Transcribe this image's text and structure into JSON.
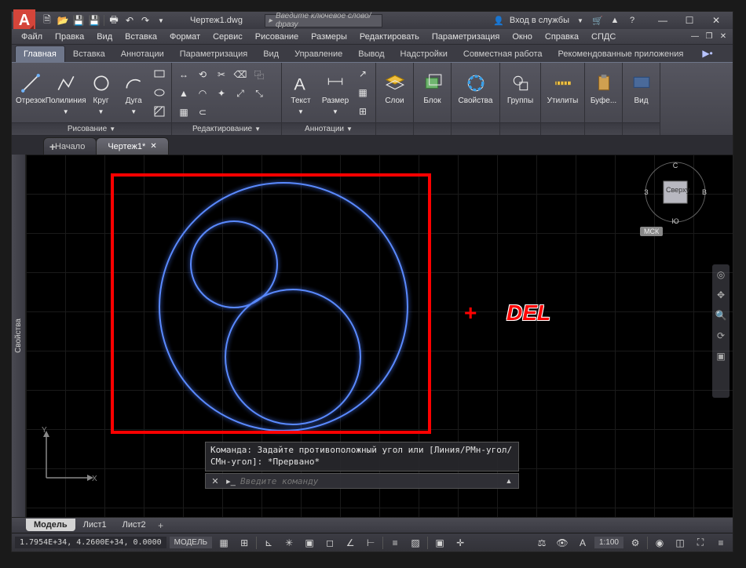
{
  "title": "Чертеж1.dwg",
  "search_placeholder": "Введите ключевое слово/фразу",
  "signin": "Вход в службы",
  "menu": {
    "file": "Файл",
    "edit": "Правка",
    "view": "Вид",
    "insert": "Вставка",
    "format": "Формат",
    "service": "Сервис",
    "draw": "Рисование",
    "dim": "Размеры",
    "modify": "Редактировать",
    "param": "Параметризация",
    "window": "Окно",
    "help": "Справка",
    "spds": "СПДС"
  },
  "ribbon_tabs": {
    "t0": "Главная",
    "t1": "Вставка",
    "t2": "Аннотации",
    "t3": "Параметризация",
    "t4": "Вид",
    "t5": "Управление",
    "t6": "Вывод",
    "t7": "Надстройки",
    "t8": "Совместная работа",
    "t9": "Рекомендованные приложения"
  },
  "panels": {
    "draw": {
      "label": "Рисование",
      "line": "Отрезок",
      "pline": "Полилиния",
      "circle": "Круг",
      "arc": "Дуга"
    },
    "modify": {
      "label": "Редактирование"
    },
    "annot": {
      "label": "Аннотации",
      "text": "Текст",
      "dim": "Размер"
    },
    "layers": {
      "label": "Слои"
    },
    "block": {
      "label": "Блок"
    },
    "props": {
      "label": "Свойства"
    },
    "groups": {
      "label": "Группы"
    },
    "util": {
      "label": "Утилиты"
    },
    "clip": {
      "label": "Буфе..."
    },
    "viewp": {
      "label": "Вид"
    }
  },
  "doc_tabs": {
    "start": "Начало",
    "d1": "Чертеж1*"
  },
  "sidebar": "Свойства",
  "viewcube": {
    "top": "Сверху",
    "n": "С",
    "s": "Ю",
    "e": "В",
    "w": "З",
    "wcs": "МСК"
  },
  "cmd_history": "Команда: Задайте противоположный угол или [Линия/РМн-угол/СМн-угол]: *Прервано*",
  "cmd_placeholder": "Введите команду",
  "model_tabs": {
    "model": "Модель",
    "l1": "Лист1",
    "l2": "Лист2"
  },
  "status": {
    "coords": "1.7954E+34, 4.2600E+34, 0.0000",
    "model": "МОДЕЛЬ",
    "scale": "1:100"
  },
  "overlay": {
    "plus": "+",
    "del": "DEL"
  }
}
